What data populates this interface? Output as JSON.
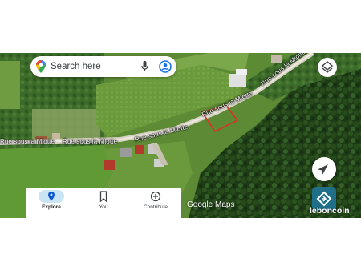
{
  "search": {
    "placeholder_text": "Search here"
  },
  "map": {
    "streets": [
      {
        "name": "Rue sous la Miotte"
      },
      {
        "name": "Rue sous la Miotte"
      },
      {
        "name": "Rue sous la Miotte"
      },
      {
        "name": "Rue sous la Miotte"
      },
      {
        "name": "Rue sous la Miotte"
      }
    ],
    "wordmark": "Google Maps",
    "highlight_color": "#d93025"
  },
  "nav": {
    "tabs": [
      {
        "label": "Explore",
        "icon": "location-pin-icon",
        "active": true
      },
      {
        "label": "You",
        "icon": "bookmark-icon",
        "active": false
      },
      {
        "label": "Contribute",
        "icon": "add-circle-icon",
        "active": false
      }
    ]
  },
  "watermark": {
    "text": "leboncoin",
    "color": "#1e6f87"
  }
}
